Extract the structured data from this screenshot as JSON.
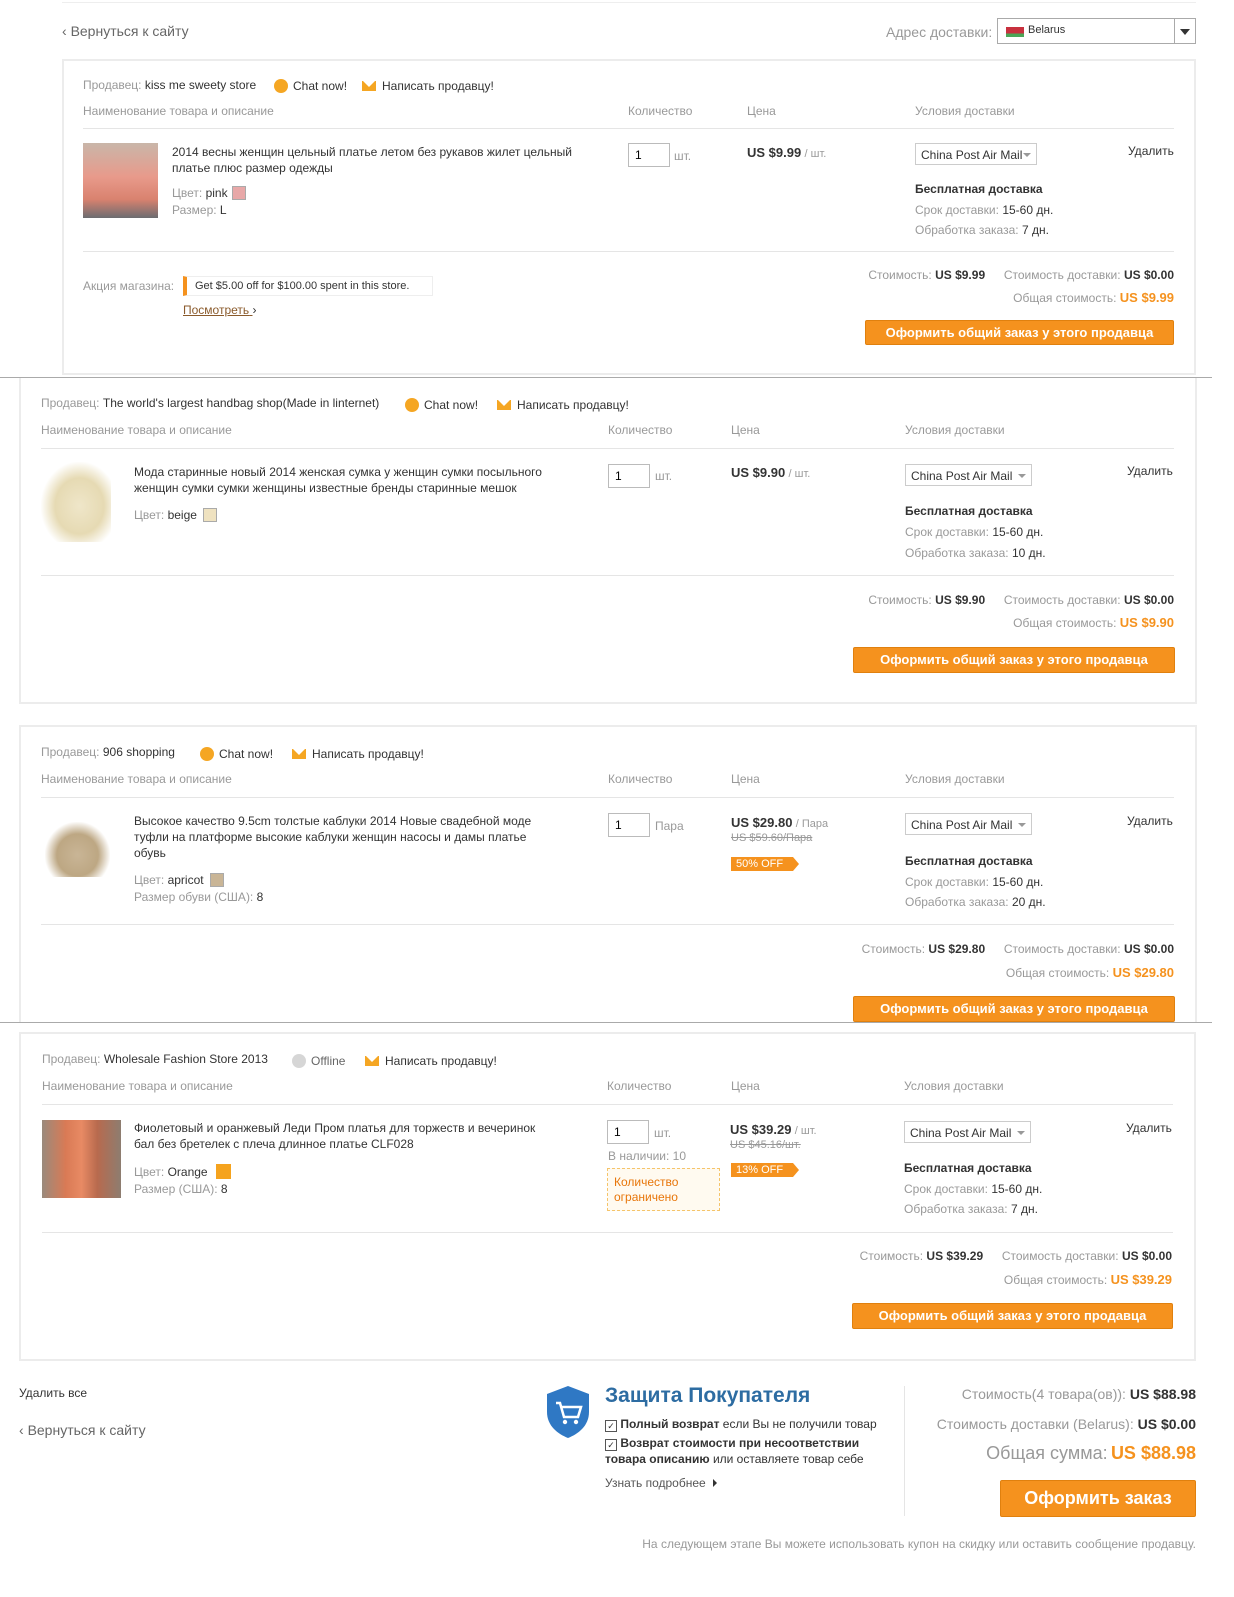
{
  "top": {
    "back_label": "Вернуться к сайту",
    "address_label": "Адрес доставки:",
    "country": "Belarus"
  },
  "colors": {
    "accent": "#f5921e",
    "border": "#ececec"
  },
  "common": {
    "col_product": "Наименование товара и описание",
    "col_qty": "Количество",
    "col_price": "Цена",
    "col_shipping": "Условия доставки",
    "seller_label": "Продавец:",
    "chat_label": "Chat now!",
    "offline_label": "Offline",
    "write_label": "Написать продавцу!",
    "delete_label": "Удалить",
    "free_shipping": "Бесплатная доставка",
    "delivery_term_label": "Срок доставки:",
    "delivery_term_value": "15-60 дн.",
    "processing_label": "Обработка заказа:",
    "color_label": "Цвет:",
    "size_label": "Размер:",
    "cost_label": "Стоимость:",
    "shipping_cost_label": "Стоимость доставки:",
    "total_label": "Общая стоимость:",
    "order_seller_button": "Оформить общий заказ у этого продавца",
    "shipping_method": "China Post Air Mail"
  },
  "stores": [
    {
      "seller": "kiss me sweety store",
      "title": "2014 весны женщин цельный платье летом без рукавов жилет цельный платье плюс размер одежды",
      "color": "pink",
      "size_label": "Размер:",
      "size": "L",
      "qty": "1",
      "unit": "шт.",
      "price": "US $9.99",
      "price_unit": "/ шт.",
      "processing": "7 дн.",
      "cost": "US $9.99",
      "shipping": "US $0.00",
      "total": "US $9.99",
      "promo_label": "Акция магазина:",
      "promo_text": "Get $5.00 off for $100.00 spent in this store.",
      "promo_link": "Посмотреть"
    },
    {
      "seller": "The world's largest handbag shop(Made in linternet)",
      "title": "Мода старинные новый 2014 женская сумка у женщин сумки посыльного женщин сумки сумки женщины известные бренды старинные мешок",
      "color": "beige",
      "qty": "1",
      "unit": "шт.",
      "price": "US $9.90",
      "price_unit": "/ шт.",
      "processing": "10 дн.",
      "cost": "US $9.90",
      "shipping": "US $0.00",
      "total": "US $9.90"
    },
    {
      "seller": "906 shopping",
      "title": "Высокое качество 9.5cm толстые каблуки 2014 Новые свадебной моде туфли на платформе высокие каблуки женщин насосы и дамы платье обувь",
      "color": "apricot",
      "size_label": "Размер обуви (США):",
      "size": "8",
      "qty": "1",
      "unit": "Пара",
      "price": "US $29.80",
      "price_unit": "/ Пара",
      "old_price": "US $59.60/Пара",
      "discount": "50% OFF",
      "processing": "20 дн.",
      "cost": "US $29.80",
      "shipping": "US $0.00",
      "total": "US $29.80"
    },
    {
      "seller": "Wholesale Fashion Store 2013",
      "title": "Фиолетовый и оранжевый Леди Пром платья для торжеств и вечеринок бал без бретелек с плеча длинное платье CLF028",
      "color": "Orange",
      "size_label": "Размер (США):",
      "size": "8",
      "qty": "1",
      "unit": "шт.",
      "stock": "В наличии: 10",
      "limited": "Количество ограничено",
      "price": "US $39.29",
      "price_unit": "/ шт.",
      "old_price": "US $45.16/шт.",
      "discount": "13% OFF",
      "processing": "7 дн.",
      "cost": "US $39.29",
      "shipping": "US $0.00",
      "total": "US $39.29"
    }
  ],
  "footer": {
    "delete_all": "Удалить все",
    "back_label": "Вернуться к сайту",
    "protection_title": "Защита Покупателя",
    "protection_1_bold": "Полный возврат",
    "protection_1_rest": " если Вы не получили товар",
    "protection_2_bold": "Возврат стоимости при несоответствии товара описанию",
    "protection_2_rest": " или оставляете товар себе",
    "learn_more": "Узнать подробнее",
    "subtotal_label": "Стоимость(4 товара(ов)):",
    "subtotal": "US $88.98",
    "shipping_label": "Стоимость доставки (Belarus):",
    "shipping": "US $0.00",
    "grand_label": "Общая сумма:",
    "grand": "US $88.98",
    "order_button": "Оформить заказ",
    "note": "На следующем этапе Вы можете использовать купон на скидку или оставить сообщение продавцу."
  }
}
